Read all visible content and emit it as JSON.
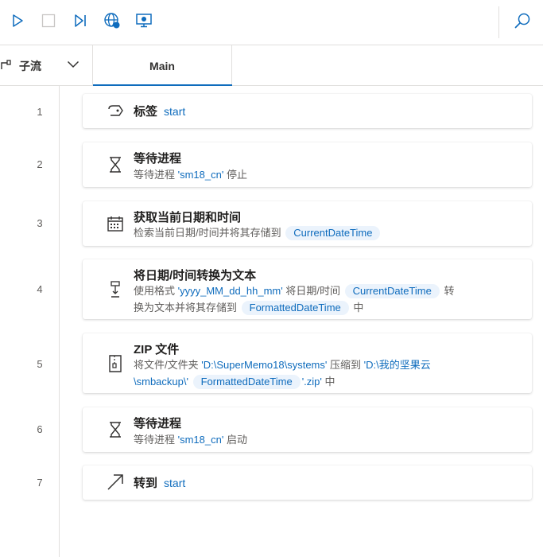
{
  "toolbar": {
    "run_icon": "play-icon",
    "stop_icon": "stop-icon",
    "step_icon": "step-next-icon",
    "web_recorder_icon": "globe-record-icon",
    "desktop_recorder_icon": "desktop-record-icon",
    "search_icon": "search-icon"
  },
  "tabs": {
    "subflow_label": "子流",
    "main_label": "Main"
  },
  "actions": [
    {
      "line": "1",
      "icon": "label-icon",
      "title": "标签",
      "inline": "start"
    },
    {
      "line": "2",
      "icon": "hourglass-icon",
      "title": "等待进程",
      "desc": {
        "pre": "等待进程 ",
        "proc": "'sm18_cn'",
        "post": " 停止"
      }
    },
    {
      "line": "3",
      "icon": "calendar-icon",
      "title": "获取当前日期和时间",
      "desc": {
        "pre": "检索当前日期/时间并将其存储到",
        "var": "CurrentDateTime"
      }
    },
    {
      "line": "4",
      "icon": "convert-icon",
      "title": "将日期/时间转换为文本",
      "desc": {
        "pre": "使用格式 ",
        "fmt": "'yyyy_MM_dd_hh_mm'",
        "mid": " 将日期/时间",
        "var1": "CurrentDateTime",
        "mid2": "转",
        "line2pre": "换为文本并将其存储到",
        "var2": "FormattedDateTime",
        "post": "中"
      }
    },
    {
      "line": "5",
      "icon": "zip-icon",
      "title": "ZIP 文件",
      "desc": {
        "pre": "将文件/文件夹 ",
        "src": "'D:\\SuperMemo18\\systems'",
        "mid": " 压缩到 ",
        "dst1": "'D:\\我的坚果云",
        "dst2": "\\smbackup\\'",
        "var": "FormattedDateTime",
        "ext": "'.zip'",
        "post": " 中"
      }
    },
    {
      "line": "6",
      "icon": "hourglass-icon",
      "title": "等待进程",
      "desc": {
        "pre": "等待进程 ",
        "proc": "'sm18_cn'",
        "post": " 启动"
      }
    },
    {
      "line": "7",
      "icon": "goto-arrow-icon",
      "title": "转到",
      "inline": "start"
    }
  ]
}
